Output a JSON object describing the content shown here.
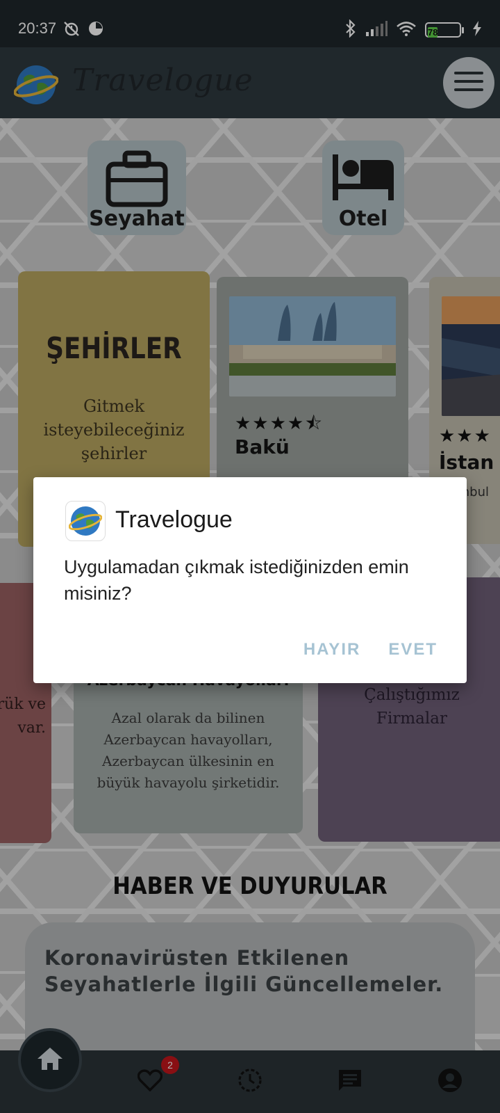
{
  "statusbar": {
    "time": "20:37",
    "battery": "78"
  },
  "appbar": {
    "title": "Travelogue",
    "menu_icon": "hamburger-icon"
  },
  "quick_actions": [
    {
      "label": "Seyahat",
      "icon": "briefcase-icon"
    },
    {
      "label": "Otel",
      "icon": "bed-icon"
    }
  ],
  "cities_card": {
    "title": "ŞEHİRLER",
    "text": "Gitmek isteyebileceğiniz şehirler"
  },
  "city_cards": [
    {
      "name": "Bakü",
      "stars": "★★★★⯪",
      "desc": ""
    },
    {
      "name": "İstan",
      "stars": "★★★",
      "desc": "İstanbul\nsidir"
    }
  ],
  "red_card": {
    "text": "rük ve\nvar."
  },
  "airline_card": {
    "title": "Azerbaycan Havayolları",
    "text": "Azal olarak da bilinen Azerbaycan havayolları, Azerbaycan ülkesinin en büyük havayolu şirketidir."
  },
  "firms_card": {
    "text": "Çalıştığımız\nFirmalar"
  },
  "news": {
    "section_title": "HABER VE DUYURULAR",
    "items": [
      {
        "title": "Koronavirüsten Etkilenen\nSeyahatlerle İlgili Güncellemeler."
      }
    ]
  },
  "bottom_nav": {
    "items": [
      "home-icon",
      "heart-icon",
      "history-icon",
      "chat-icon",
      "account-icon"
    ],
    "favorites_badge": "2"
  },
  "dialog": {
    "title": "Travelogue",
    "message": "Uygulamadan çıkmak istediğinizden emin misiniz?",
    "negative": "HAYIR",
    "positive": "EVET"
  },
  "colors": {
    "accent": "#a6c3d3",
    "appbar": "#2e3a40",
    "badge": "#c4161c"
  }
}
